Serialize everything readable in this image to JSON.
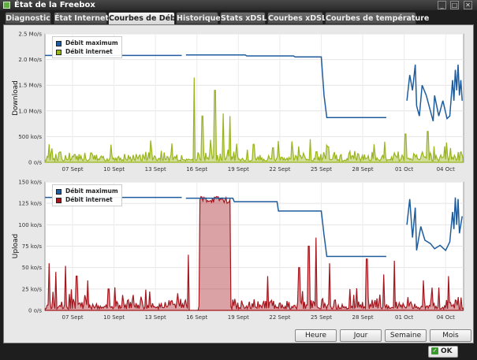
{
  "window": {
    "title": "État de la Freebox",
    "minimize": "_",
    "maximize": "□",
    "close": "✕"
  },
  "tabs": [
    {
      "label": "Diagnostic",
      "active": false
    },
    {
      "label": "État Internet",
      "active": false
    },
    {
      "label": "Courbes de Débit",
      "active": true
    },
    {
      "label": "Historique",
      "active": false
    },
    {
      "label": "Stats xDSL",
      "active": false
    },
    {
      "label": "Courbes xDSL",
      "active": false
    },
    {
      "label": "Courbes de température",
      "active": false
    }
  ],
  "colors": {
    "max": "#1f5c9e",
    "download": "#9ab51c",
    "upload": "#a5171f"
  },
  "range_buttons": {
    "hour": "Heure",
    "day": "Jour",
    "week": "Semaine",
    "month": "Mois"
  },
  "ok": {
    "label": "OK",
    "icon": "check-icon"
  },
  "chart_data": [
    {
      "type": "line",
      "ylabel": "Download",
      "yticks": [
        "0 o/s",
        "500 ko/s",
        "1.0 Mo/s",
        "1.5 Mo/s",
        "2.0 Mo/s",
        "2.5 Mo/s"
      ],
      "ylim": [
        0,
        2.5
      ],
      "y_unit": "Mo/s",
      "xticks": [
        "07 Sept",
        "10 Sept",
        "13 Sept",
        "16 Sept",
        "19 Sept",
        "22 Sept",
        "25 Sept",
        "28 Sept",
        "01 Oct",
        "04 Oct"
      ],
      "xlim": [
        5,
        35.3
      ],
      "legend": [
        "Débit maximum",
        "Débit internet"
      ],
      "max_series": [
        [
          5,
          2.08
        ],
        [
          14.9,
          2.08
        ],
        [
          null,
          null
        ],
        [
          15.2,
          2.09
        ],
        [
          19.5,
          2.09
        ],
        [
          19.6,
          2.07
        ],
        [
          23,
          2.07
        ],
        [
          23.1,
          2.05
        ],
        [
          25,
          2.05
        ],
        [
          25.2,
          1.3
        ],
        [
          25.4,
          0.87
        ],
        [
          29.7,
          0.87
        ],
        [
          null,
          null
        ],
        [
          31.2,
          1.2
        ],
        [
          31.4,
          1.7
        ],
        [
          31.6,
          1.4
        ],
        [
          31.8,
          1.9
        ],
        [
          31.9,
          1.1
        ],
        [
          32.1,
          0.9
        ],
        [
          32.3,
          1.5
        ],
        [
          32.6,
          1.3
        ],
        [
          32.9,
          1.0
        ],
        [
          33.1,
          0.8
        ],
        [
          33.2,
          1.3
        ],
        [
          33.5,
          0.9
        ],
        [
          33.8,
          1.2
        ],
        [
          34.1,
          0.85
        ],
        [
          34.3,
          0.9
        ],
        [
          34.5,
          1.6
        ],
        [
          34.6,
          1.2
        ],
        [
          34.7,
          1.8
        ],
        [
          34.8,
          1.4
        ],
        [
          34.9,
          1.9
        ],
        [
          35.0,
          1.3
        ],
        [
          35.1,
          1.6
        ],
        [
          35.2,
          1.2
        ]
      ],
      "traffic_peaks": [
        [
          5.3,
          0.35
        ],
        [
          6.1,
          0.2
        ],
        [
          7.2,
          0.15
        ],
        [
          8.4,
          0.18
        ],
        [
          9.8,
          0.12
        ],
        [
          11.2,
          0.1
        ],
        [
          13.4,
          0.2
        ],
        [
          15.8,
          1.65
        ],
        [
          16.4,
          0.9
        ],
        [
          17.3,
          1.4
        ],
        [
          17.9,
          0.95
        ],
        [
          18.4,
          0.9
        ],
        [
          20.1,
          0.35
        ],
        [
          21.5,
          0.28
        ],
        [
          22.9,
          0.25
        ],
        [
          24.2,
          0.45
        ],
        [
          25.5,
          0.3
        ],
        [
          27.4,
          0.22
        ],
        [
          28.8,
          0.35
        ],
        [
          29.6,
          0.4
        ],
        [
          31.1,
          0.55
        ],
        [
          32.7,
          0.6
        ],
        [
          34.9,
          0.2
        ]
      ]
    },
    {
      "type": "line",
      "ylabel": "Upload",
      "yticks": [
        "0 o/s",
        "25 ko/s",
        "50 ko/s",
        "75 ko/s",
        "100 ko/s",
        "125 ko/s",
        "150 ko/s"
      ],
      "ylim": [
        0,
        150
      ],
      "y_unit": "ko/s",
      "xticks": [
        "07 Sept",
        "10 Sept",
        "13 Sept",
        "16 Sept",
        "19 Sept",
        "22 Sept",
        "25 Sept",
        "28 Sept",
        "01 Oct",
        "04 Oct"
      ],
      "xlim": [
        5,
        35.3
      ],
      "legend": [
        "Débit maximum",
        "Débit internet"
      ],
      "max_series": [
        [
          5,
          132
        ],
        [
          14.9,
          132
        ],
        [
          null,
          null
        ],
        [
          15.2,
          131
        ],
        [
          18.6,
          131
        ],
        [
          18.7,
          127
        ],
        [
          21.8,
          127
        ],
        [
          21.9,
          116
        ],
        [
          25,
          116
        ],
        [
          25.2,
          88
        ],
        [
          25.4,
          63
        ],
        [
          29.7,
          63
        ],
        [
          null,
          null
        ],
        [
          31.2,
          100
        ],
        [
          31.4,
          130
        ],
        [
          31.6,
          85
        ],
        [
          31.8,
          120
        ],
        [
          31.9,
          70
        ],
        [
          32.2,
          98
        ],
        [
          32.5,
          82
        ],
        [
          32.9,
          78
        ],
        [
          33.2,
          72
        ],
        [
          33.6,
          76
        ],
        [
          34.0,
          70
        ],
        [
          34.3,
          80
        ],
        [
          34.5,
          115
        ],
        [
          34.6,
          95
        ],
        [
          34.7,
          132
        ],
        [
          34.8,
          100
        ],
        [
          34.9,
          130
        ],
        [
          35.0,
          90
        ],
        [
          35.2,
          110
        ]
      ],
      "traffic_peaks": [
        [
          5.3,
          55
        ],
        [
          5.8,
          45
        ],
        [
          6.5,
          52
        ],
        [
          7.3,
          40
        ],
        [
          8.1,
          35
        ],
        [
          9.6,
          25
        ],
        [
          11.4,
          18
        ],
        [
          12.6,
          22
        ],
        [
          14.6,
          20
        ],
        [
          15.4,
          65
        ],
        [
          15.6,
          75
        ],
        [
          21.1,
          40
        ],
        [
          23.4,
          50
        ],
        [
          24.1,
          75
        ],
        [
          24.6,
          85
        ],
        [
          25.6,
          55
        ],
        [
          28.3,
          60
        ],
        [
          29.5,
          42
        ],
        [
          30.3,
          58
        ],
        [
          32.4,
          35
        ],
        [
          34.2,
          40
        ],
        [
          35.1,
          15
        ]
      ]
    }
  ]
}
